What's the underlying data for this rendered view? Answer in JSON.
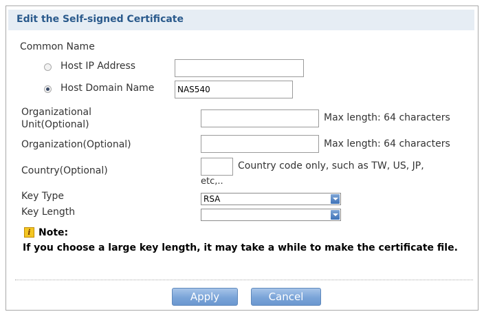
{
  "header": {
    "title": "Edit the Self-signed Certificate"
  },
  "common_name": {
    "label": "Common Name",
    "options": [
      {
        "label": "Host IP Address",
        "checked": false,
        "value": ""
      },
      {
        "label": "Host Domain Name",
        "checked": true,
        "value": "NAS540"
      }
    ]
  },
  "fields": {
    "org_unit": {
      "label_line1": "Organizational",
      "label_line2": "Unit(Optional)",
      "value": "",
      "hint": "Max length: 64 characters"
    },
    "organization": {
      "label": "Organization(Optional)",
      "value": "",
      "hint": "Max length: 64 characters"
    },
    "country": {
      "label": "Country(Optional)",
      "value": "",
      "hint_line1": "Country code only, such as TW, US, JP,",
      "hint_line2": "etc,.."
    },
    "key_type": {
      "label": "Key Type",
      "selected": "RSA"
    },
    "key_length": {
      "label": "Key Length",
      "selected": ""
    }
  },
  "note": {
    "icon": "note-icon",
    "title": "Note:",
    "text": "If you choose a large key length, it may take a while to make the certificate file."
  },
  "buttons": {
    "apply": "Apply",
    "cancel": "Cancel"
  },
  "colors": {
    "header_bg": "#e6edf4",
    "header_text": "#2a5a8c",
    "button": "#7aa4d8"
  }
}
